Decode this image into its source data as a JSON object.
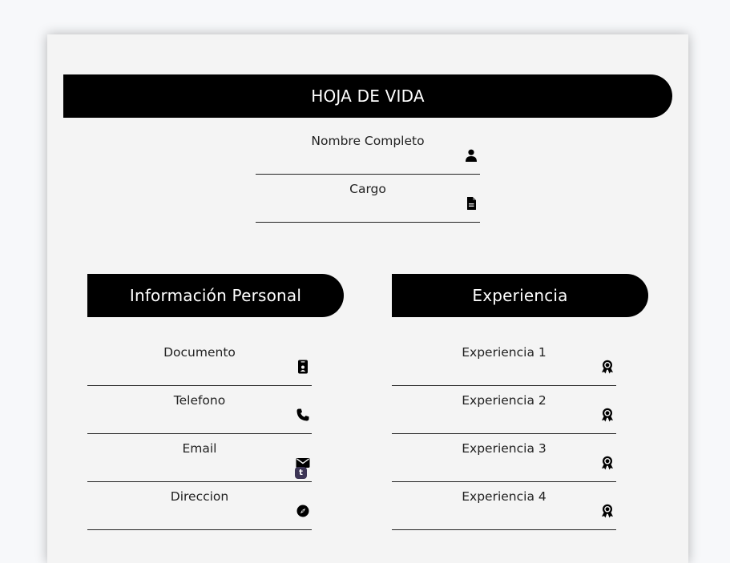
{
  "header": {
    "title": "HOJA DE VIDA"
  },
  "top_fields": [
    {
      "label": "Nombre Completo",
      "icon": "user-icon"
    },
    {
      "label": "Cargo",
      "icon": "document-icon"
    }
  ],
  "personal": {
    "title": "Información Personal",
    "fields": [
      {
        "label": "Documento",
        "icon": "id-card-icon"
      },
      {
        "label": "Telefono",
        "icon": "phone-icon"
      },
      {
        "label": "Email",
        "icon": "envelope-icon",
        "badge": "t"
      },
      {
        "label": "Direccion",
        "icon": "compass-icon"
      }
    ]
  },
  "experience": {
    "title": "Experiencia",
    "fields": [
      {
        "label": "Experiencia 1",
        "icon": "award-icon"
      },
      {
        "label": "Experiencia 2",
        "icon": "award-icon"
      },
      {
        "label": "Experiencia 3",
        "icon": "award-icon"
      },
      {
        "label": "Experiencia 4",
        "icon": "award-icon"
      }
    ]
  },
  "colors": {
    "banner": "#000000",
    "card": "#f4f4f4",
    "page": "#f7f8fa",
    "badge": "#3d3656"
  }
}
